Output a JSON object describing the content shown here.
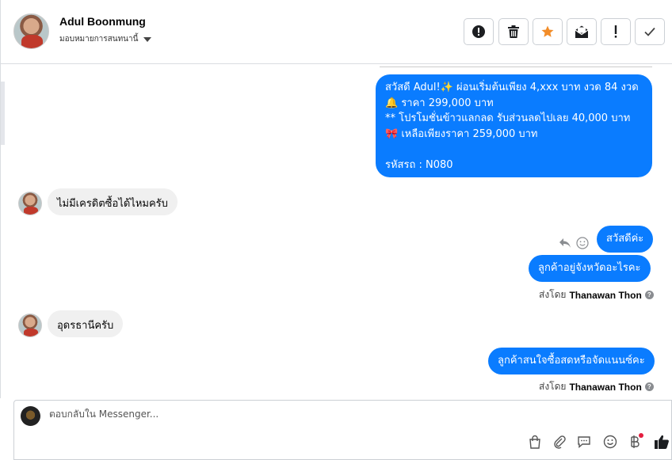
{
  "header": {
    "name": "Adul Boonmung",
    "assign_label": "มอบหมายการสนทนานี้",
    "buttons": [
      {
        "name": "alert-button",
        "icon": "exclamation-circle-icon"
      },
      {
        "name": "delete-button",
        "icon": "trash-icon"
      },
      {
        "name": "star-button",
        "icon": "star-icon",
        "color": "#f28c28"
      },
      {
        "name": "mark-unread-button",
        "icon": "envelope-icon"
      },
      {
        "name": "spam-button",
        "icon": "exclamation-icon"
      },
      {
        "name": "done-button",
        "icon": "checkmark-icon"
      }
    ]
  },
  "messages": {
    "promo_lines": [
      "สวัสดี Adul!✨  ผ่อนเริ่มต้นเพียง 4,xxx บาท งวด 84 งวด",
      "🔔 ราคา 299,000 บาท",
      "** โปรโมชั่นข้าวแลกลด รับส่วนลดไปเลย 40,000 บาท",
      "🎀  เหลือเพียงราคา 259,000 บาท",
      "",
      " รหัสรถ : N080"
    ],
    "in1": "ไม่มีเครดิตซื้อได้ไหมครับ",
    "out1": "สวัสดีค่ะ",
    "out2": "ลูกค้าอยู่จังหวัดอะไรคะ",
    "sent_by_1_label": "ส่งโดย",
    "sent_by_1_name": "Thanawan Thon",
    "in2": "อุดรธานีครับ",
    "out3": "ลูกค้าสนใจซื้อสดหรือจัดแนนซ์คะ",
    "sent_by_2_label": "ส่งโดย",
    "sent_by_2_name": "Thanawan Thon"
  },
  "composer": {
    "placeholder": "ตอบกลับใน Messenger...",
    "icons": [
      "shopping-bag-icon",
      "paperclip-icon",
      "saved-reply-icon",
      "emoji-icon",
      "baht-payment-icon",
      "thumbs-up-icon"
    ]
  },
  "colors": {
    "accent": "#0a7cff",
    "incoming_bubble": "#f0f0f0",
    "star": "#f28c28",
    "notification_dot": "#e41e3f"
  }
}
